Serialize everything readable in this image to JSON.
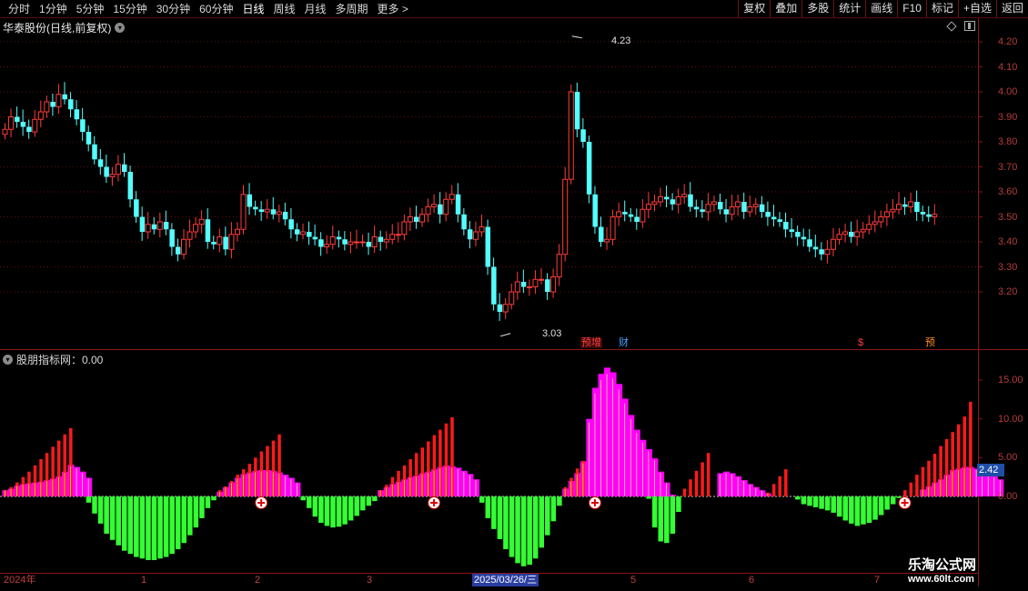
{
  "toolbar": {
    "periods": [
      "分时",
      "1分钟",
      "5分钟",
      "15分钟",
      "30分钟",
      "60分钟",
      "日线",
      "周线",
      "月线",
      "多周期",
      "更多 >"
    ],
    "active_period": "日线",
    "tools": [
      "复权",
      "叠加",
      "多股",
      "统计",
      "画线",
      "F10",
      "标记",
      "+自选",
      "返回"
    ]
  },
  "chart": {
    "title": "华泰股份(日线,前复权)",
    "high_marker": "4.23",
    "low_marker": "3.03",
    "y_ticks": [
      "4.20",
      "4.10",
      "4.00",
      "3.90",
      "3.80",
      "3.70",
      "3.60",
      "3.50",
      "3.40",
      "3.30",
      "3.20"
    ],
    "events": [
      {
        "label": "预增",
        "color": "#ff4040"
      },
      {
        "label": "财",
        "color": "#4aa0ff"
      },
      {
        "label": "$",
        "color": "#ff4040"
      },
      {
        "label": "预",
        "color": "#ff8c20"
      }
    ]
  },
  "indicator": {
    "title": "股朋指标网：0.00",
    "current_value": "2.42",
    "y_ticks": [
      "15.00",
      "10.00",
      "5.00",
      "0.00"
    ]
  },
  "date_axis": {
    "labels": [
      "2024年",
      "1",
      "2",
      "3",
      "2025/03/26/三",
      "5",
      "6",
      "7"
    ],
    "selected": "2025/03/26/三"
  },
  "watermark": {
    "line1": "乐淘公式网",
    "line2": "www.60lt.com"
  },
  "chart_data": [
    {
      "type": "candlestick",
      "title": "华泰股份(日线,前复权)",
      "ylim": [
        3.03,
        4.23
      ],
      "y_ticks": [
        3.2,
        3.3,
        3.4,
        3.5,
        3.6,
        3.7,
        3.8,
        3.9,
        4.0,
        4.1,
        4.2
      ],
      "max_price": 4.23,
      "min_price": 3.03,
      "close": [
        3.85,
        3.9,
        3.88,
        3.86,
        3.84,
        3.89,
        3.92,
        3.96,
        3.94,
        3.99,
        3.97,
        3.93,
        3.89,
        3.84,
        3.79,
        3.73,
        3.7,
        3.66,
        3.67,
        3.71,
        3.68,
        3.57,
        3.5,
        3.44,
        3.47,
        3.45,
        3.48,
        3.45,
        3.38,
        3.35,
        3.41,
        3.44,
        3.47,
        3.49,
        3.4,
        3.39,
        3.42,
        3.37,
        3.43,
        3.45,
        3.59,
        3.54,
        3.53,
        3.52,
        3.53,
        3.51,
        3.52,
        3.49,
        3.45,
        3.43,
        3.44,
        3.42,
        3.41,
        3.38,
        3.39,
        3.42,
        3.41,
        3.39,
        3.4,
        3.4,
        3.4,
        3.38,
        3.42,
        3.4,
        3.41,
        3.43,
        3.43,
        3.48,
        3.5,
        3.48,
        3.51,
        3.54,
        3.55,
        3.51,
        3.57,
        3.59,
        3.51,
        3.45,
        3.41,
        3.44,
        3.46,
        3.3,
        3.15,
        3.12,
        3.15,
        3.2,
        3.24,
        3.22,
        3.22,
        3.25,
        3.25,
        3.2,
        3.26,
        3.35,
        3.65,
        4.0,
        3.85,
        3.8,
        3.59,
        3.46,
        3.4,
        3.41,
        3.5,
        3.52,
        3.51,
        3.5,
        3.48,
        3.53,
        3.55,
        3.56,
        3.58,
        3.57,
        3.55,
        3.58,
        3.59,
        3.54,
        3.53,
        3.52,
        3.55,
        3.56,
        3.53,
        3.51,
        3.54,
        3.56,
        3.52,
        3.54,
        3.55,
        3.52,
        3.5,
        3.49,
        3.48,
        3.45,
        3.44,
        3.42,
        3.41,
        3.38,
        3.37,
        3.35,
        3.37,
        3.41,
        3.43,
        3.44,
        3.42,
        3.44,
        3.45,
        3.47,
        3.48,
        3.5,
        3.52,
        3.53,
        3.55,
        3.54,
        3.56,
        3.52,
        3.51,
        3.5,
        3.51
      ]
    },
    {
      "type": "bar",
      "title": "股朋指标网：0.00",
      "ylim": [
        -9,
        18
      ],
      "y_ticks": [
        0,
        5,
        10,
        15
      ],
      "current_value": 2.42,
      "series": [
        {
          "values": [
            0.8,
            1.2,
            1.8,
            2.5,
            3.2,
            4.0,
            4.8,
            5.6,
            6.4,
            7.2,
            8.0,
            8.8,
            0,
            0,
            -0.8,
            -2.2,
            -3.5,
            -4.8,
            -5.6,
            -6.3,
            -7.0,
            -7.4,
            -7.8,
            -8.0,
            -8.2,
            -8.2,
            -8.0,
            -7.8,
            -7.4,
            -6.8,
            -6.0,
            -5.0,
            -4.0,
            -2.8,
            -1.5,
            -0.5,
            0.8,
            1.3,
            2.0,
            2.8,
            3.5,
            4.2,
            5.0,
            5.8,
            6.5,
            7.2,
            8.0,
            0,
            0,
            0,
            -0.5,
            -1.5,
            -2.6,
            -3.4,
            -3.8,
            -4.0,
            -3.9,
            -3.6,
            -3.1,
            -2.5,
            -1.8,
            -1.2,
            -0.6,
            0.8,
            1.5,
            2.5,
            3.3,
            4.0,
            4.8,
            5.6,
            6.3,
            7.1,
            7.9,
            8.6,
            9.4,
            10.2,
            0,
            0,
            0,
            0,
            -0.8,
            -2.8,
            -4.2,
            -5.5,
            -6.8,
            -7.8,
            -8.6,
            -9.0,
            -8.8,
            -8.0,
            -6.6,
            -5.0,
            -3.2,
            -1.2,
            1.2,
            2.4,
            3.6,
            4.6,
            0,
            0,
            0,
            0,
            0,
            0,
            0,
            0,
            0,
            0,
            -0.3,
            -4.0,
            -5.8,
            -6.0,
            -4.8,
            -2.0,
            1.0,
            2.2,
            3.3,
            4.4,
            5.6,
            0,
            0,
            0,
            0,
            0,
            0,
            0,
            0,
            0,
            0.5,
            1.6,
            2.6,
            3.5,
            0,
            -0.4,
            -1.0,
            -1.2,
            -1.4,
            -1.6,
            -1.8,
            -2.1,
            -2.6,
            -3.1,
            -3.5,
            -3.8,
            -3.6,
            -3.4,
            -3.0,
            -2.4,
            -1.7,
            -1.0,
            -0.2,
            0.8,
            1.8,
            2.8,
            3.8,
            4.6,
            5.5,
            6.5,
            7.4,
            8.3,
            9.3,
            10.3,
            12.2,
            0,
            0,
            0,
            0,
            0
          ]
        },
        {
          "values": [
            0.8,
            1.0,
            1.4,
            1.6,
            1.7,
            1.8,
            1.9,
            2.1,
            2.3,
            2.6,
            3.2,
            4.1,
            3.8,
            3.2,
            2.4,
            0,
            0,
            0,
            0,
            0,
            0,
            0,
            0,
            0,
            0,
            0,
            0,
            0,
            0,
            0,
            0,
            0,
            0,
            0,
            0,
            0,
            0.6,
            1.2,
            1.8,
            2.4,
            2.9,
            3.1,
            3.3,
            3.4,
            3.4,
            3.3,
            3.1,
            2.8,
            2.4,
            1.8,
            0,
            0,
            0,
            0,
            0,
            0,
            0,
            0,
            0,
            0,
            0,
            0,
            0,
            0.8,
            1.2,
            1.6,
            1.9,
            2.2,
            2.5,
            2.7,
            3.0,
            3.2,
            3.5,
            3.8,
            4.0,
            3.9,
            3.7,
            3.3,
            2.9,
            2.2,
            0,
            0,
            0,
            0,
            0,
            0,
            0,
            0,
            0,
            0,
            0,
            0,
            0,
            0,
            1.0,
            2.0,
            3.0,
            4.5,
            10.0,
            14.0,
            15.8,
            16.6,
            16.0,
            14.5,
            12.6,
            10.5,
            8.6,
            7.3,
            6.1,
            4.9,
            3.2,
            1.8,
            0.2,
            0,
            0,
            0,
            0,
            0,
            0,
            0,
            3.0,
            3.2,
            3.0,
            2.6,
            2.1,
            1.6,
            1.2,
            0.8,
            0.4,
            0,
            0,
            0,
            0,
            0,
            0,
            0,
            0,
            0,
            0,
            0,
            0,
            0,
            0,
            0,
            0,
            0,
            0,
            0,
            0,
            0,
            0,
            0,
            0,
            0,
            0.9,
            1.3,
            1.8,
            2.2,
            2.8,
            3.4,
            3.6,
            3.8,
            3.8,
            3.6,
            3.3,
            3.0,
            2.6,
            2.2
          ]
        }
      ]
    }
  ]
}
